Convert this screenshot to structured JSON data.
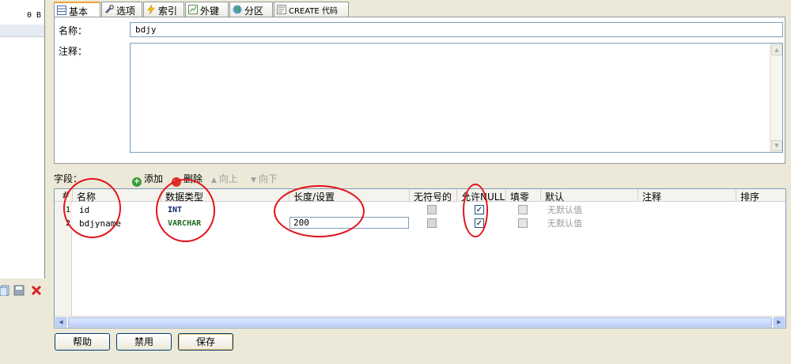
{
  "left_panel": {
    "size_text": "0 B"
  },
  "tabs": [
    {
      "label": "基本",
      "icon": "table-icon"
    },
    {
      "label": "选项",
      "icon": "wrench-icon"
    },
    {
      "label": "索引",
      "icon": "lightning-icon"
    },
    {
      "label": "外键",
      "icon": "chart-icon"
    },
    {
      "label": "分区",
      "icon": "globe-icon"
    },
    {
      "label": "CREATE 代码",
      "icon": "code-icon"
    }
  ],
  "form": {
    "name_label": "名称：",
    "name_value": "bdjy",
    "comment_label": "注释：",
    "comment_value": ""
  },
  "fields_toolbar": {
    "label": "字段：",
    "add": "添加",
    "delete": "删除",
    "up": "向上",
    "down": "向下"
  },
  "grid": {
    "headers": {
      "num": "#",
      "name": "名称",
      "type": "数据类型",
      "length": "长度/设置",
      "unsigned": "无符号的",
      "allow_null": "允许NULL",
      "zerofill": "填零",
      "default": "默认",
      "comment": "注释",
      "order": "排序"
    },
    "rows": [
      {
        "num": "1",
        "name": "id",
        "type": "INT",
        "length": "",
        "unsigned": false,
        "allow_null": true,
        "zerofill": false,
        "default": "无默认值",
        "comment": ""
      },
      {
        "num": "2",
        "name": "bdjyname",
        "type": "VARCHAR",
        "length": "200",
        "unsigned": false,
        "allow_null": true,
        "zerofill": false,
        "default": "无默认值",
        "comment": ""
      }
    ]
  },
  "buttons": {
    "help": "帮助",
    "discard": "禁用",
    "save": "保存"
  },
  "colors": {
    "annotation": "#e3131b",
    "tab_accent": "#f2a33a"
  }
}
